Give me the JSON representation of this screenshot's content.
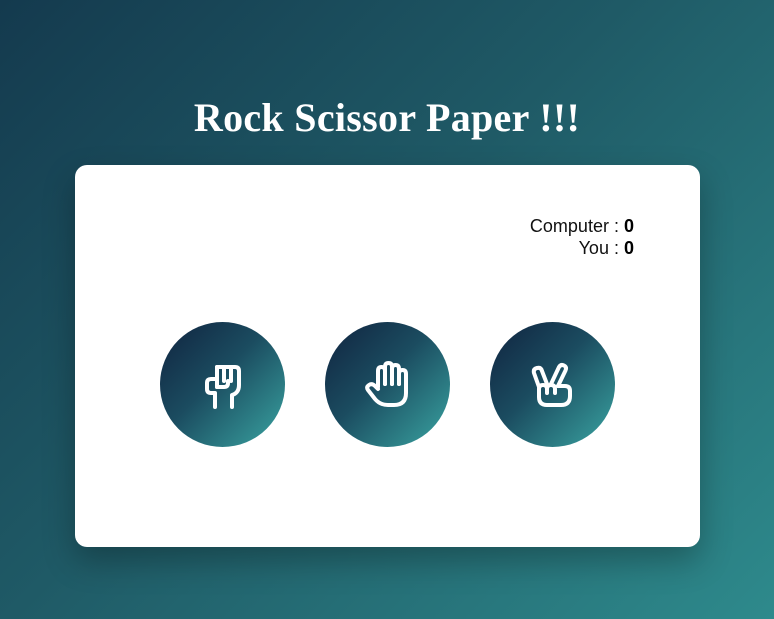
{
  "title": "Rock Scissor Paper !!!",
  "scoreboard": {
    "computer_label": "Computer :",
    "computer_score": "0",
    "you_label": "You :",
    "you_score": "0"
  },
  "choices": [
    {
      "name": "rock",
      "icon": "fist-icon"
    },
    {
      "name": "paper",
      "icon": "open-hand-icon"
    },
    {
      "name": "scissor",
      "icon": "peace-hand-icon"
    }
  ],
  "colors": {
    "background_start": "#143a4e",
    "background_end": "#2e8a8c",
    "button_start": "#10233f",
    "button_end": "#3aa5a2",
    "card": "#ffffff"
  }
}
